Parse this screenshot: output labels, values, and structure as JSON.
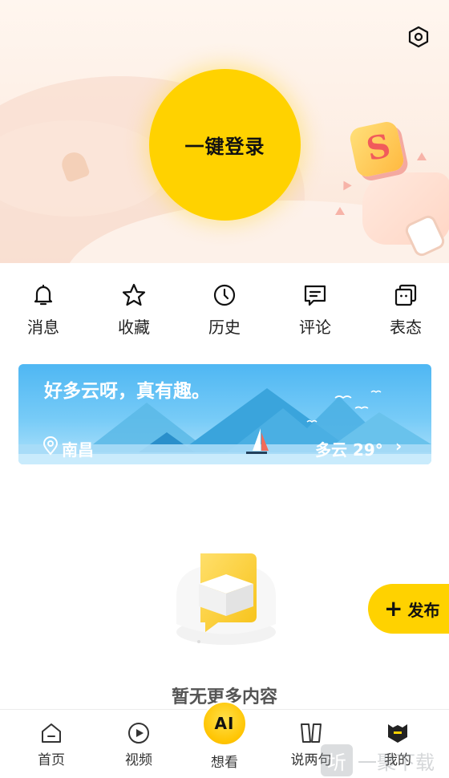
{
  "header": {
    "settings_icon": "settings-hexagon-icon",
    "login_label": "一键登录"
  },
  "quick_actions": [
    {
      "label": "消息",
      "icon": "bell-icon"
    },
    {
      "label": "收藏",
      "icon": "star-icon"
    },
    {
      "label": "历史",
      "icon": "clock-icon"
    },
    {
      "label": "评论",
      "icon": "comment-icon"
    },
    {
      "label": "表态",
      "icon": "reaction-icon"
    }
  ],
  "weather": {
    "slogan": "好多云呀，真有趣。",
    "city": "南昌",
    "condition": "多云 29°",
    "chevron": "›"
  },
  "empty_state": {
    "text": "暂无更多内容"
  },
  "publish": {
    "plus": "+",
    "label": "发布"
  },
  "bottom_nav": {
    "items": [
      {
        "label": "首页",
        "icon": "home-icon"
      },
      {
        "label": "视频",
        "icon": "play-circle-icon"
      },
      {
        "label": "想看",
        "icon": "ai-icon"
      },
      {
        "label": "说两句",
        "icon": "book-icon"
      },
      {
        "label": "我的",
        "icon": "profile-icon"
      }
    ],
    "ai_badge": "AI"
  },
  "watermark": {
    "logo_char": "圻",
    "text": "一聚下载"
  },
  "colors": {
    "accent": "#ffd200",
    "hero_bg": "#fdeee4",
    "weather_sky": "#4fb7f3"
  }
}
